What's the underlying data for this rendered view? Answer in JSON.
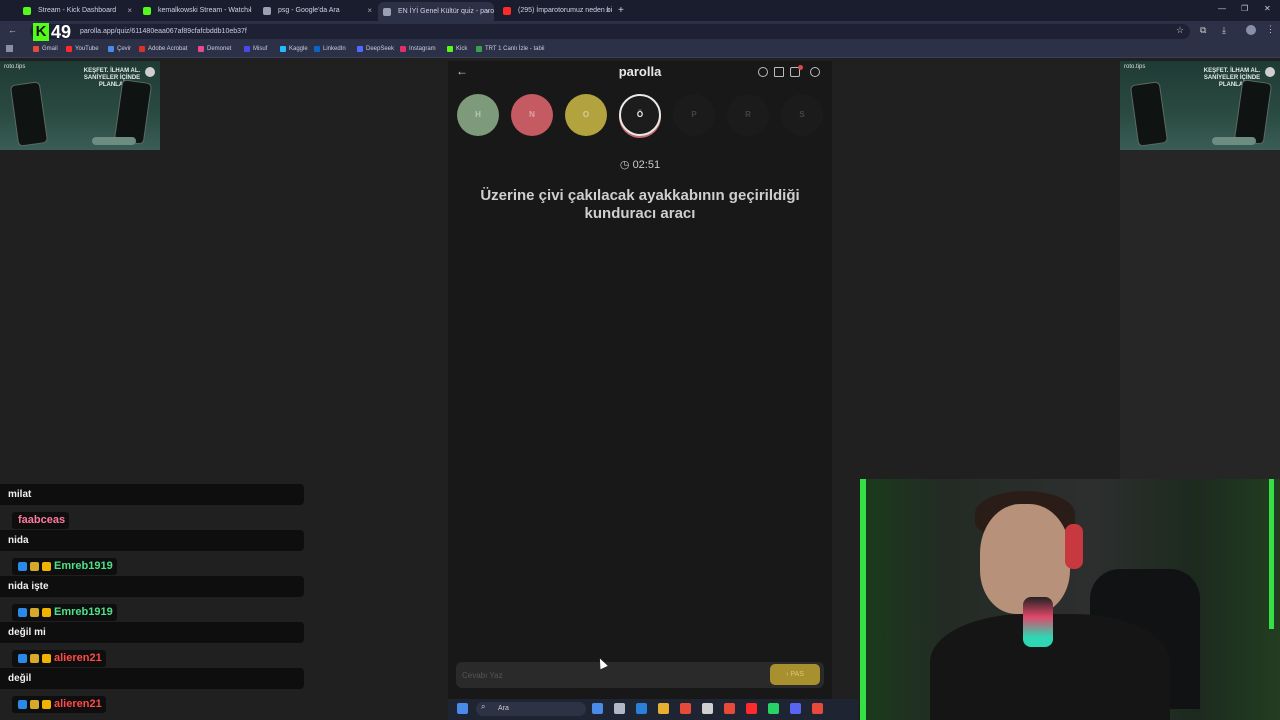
{
  "browser": {
    "tabs": [
      {
        "title": "Stream - Kick Dashboard",
        "favicon_color": "#53fc18",
        "active": false
      },
      {
        "title": "kemalkowski Stream - Watch l",
        "favicon_color": "#53fc18",
        "active": false
      },
      {
        "title": "psg - Google'da Ara",
        "favicon_color": "#9aa0b4",
        "active": false
      },
      {
        "title": "EN İYİ Genel Kültür quiz - paro",
        "favicon_color": "#9aa0b4",
        "active": true
      },
      {
        "title": "(295) İmparotorumuz neden bi",
        "favicon_color": "#ff2a2a",
        "active": false
      }
    ],
    "new_tab": "+",
    "close_glyph": "×",
    "url": "parolla.app/quiz/611480eaa067af89cfafcbddb10eb37f",
    "bookmarks": [
      {
        "label": "Gmail",
        "color": "#e84a3a"
      },
      {
        "label": "YouTube",
        "color": "#ff2a2a"
      },
      {
        "label": "Çevir",
        "color": "#4a8ae8"
      },
      {
        "label": "Adobe Acrobat",
        "color": "#d8322a"
      },
      {
        "label": "Demonet",
        "color": "#e84a8a"
      },
      {
        "label": "Misuf",
        "color": "#4a4ae8"
      },
      {
        "label": "Kaggle",
        "color": "#20beff"
      },
      {
        "label": "LinkedIn",
        "color": "#0a66c2"
      },
      {
        "label": "DeepSeek",
        "color": "#4d6bfe"
      },
      {
        "label": "Instagram",
        "color": "#e1306c"
      },
      {
        "label": "Kick",
        "color": "#53fc18"
      },
      {
        "label": "TRT 1 Canlı İzle - tabii",
        "color": "#3aa050"
      }
    ]
  },
  "overlay": {
    "kick_logo_letter": "K",
    "kick_count": "49"
  },
  "ads": {
    "brand": "roto.tips",
    "tagline": "KEŞFET. İLHAM AL. SANİYELER İÇİNDE PLANLA!"
  },
  "app": {
    "back": "←",
    "title": "parolla",
    "letters": [
      {
        "char": "H",
        "state": "answered",
        "color": "#7d9a7a"
      },
      {
        "char": "N",
        "state": "wrong",
        "color": "#c45a62"
      },
      {
        "char": "O",
        "state": "passed",
        "color": "#b3a33e"
      },
      {
        "char": "Ö",
        "state": "current",
        "color": "#1c1c1c"
      },
      {
        "char": "P",
        "state": "pending",
        "color": "#1b1b1b"
      },
      {
        "char": "R",
        "state": "pending",
        "color": "#1b1b1b"
      },
      {
        "char": "S",
        "state": "pending",
        "color": "#1b1b1b"
      }
    ],
    "timer": "02:51",
    "question": "Üzerine çivi çakılacak ayakkabının geçirildiği kunduracı aracı",
    "answer_placeholder": "Cevabı Yaz",
    "pass_label": "› PAS"
  },
  "chat": [
    {
      "type": "message",
      "text": "milat"
    },
    {
      "type": "user",
      "name": "faabceas",
      "color": "#ff7aa0",
      "badges": []
    },
    {
      "type": "message",
      "text": "nida"
    },
    {
      "type": "user",
      "name": "Emreb1919",
      "color": "#4fe08a",
      "badges": [
        "#2a8ae8",
        "#d6a92a",
        "#f0b400"
      ]
    },
    {
      "type": "message",
      "text": "nida işte"
    },
    {
      "type": "user",
      "name": "Emreb1919",
      "color": "#4fe08a",
      "badges": [
        "#2a8ae8",
        "#d6a92a",
        "#f0b400"
      ]
    },
    {
      "type": "message",
      "text": "değil mi"
    },
    {
      "type": "user",
      "name": "alieren21",
      "color": "#ff4a4a",
      "badges": [
        "#2a8ae8",
        "#d6a92a",
        "#f0b400"
      ]
    },
    {
      "type": "message",
      "text": "değil"
    },
    {
      "type": "user",
      "name": "alieren21",
      "color": "#ff4a4a",
      "badges": [
        "#2a8ae8",
        "#d6a92a",
        "#f0b400"
      ]
    }
  ],
  "taskbar": {
    "search_label": "Ara",
    "apps": [
      "#4a8ae8",
      "#b0b8c8",
      "#2a7fd8",
      "#e8b030",
      "#e84a3a",
      "#d0d0d0",
      "#e84a3a",
      "#ff2a2a",
      "#25d366",
      "#5865f2",
      "#e84a3a"
    ]
  }
}
